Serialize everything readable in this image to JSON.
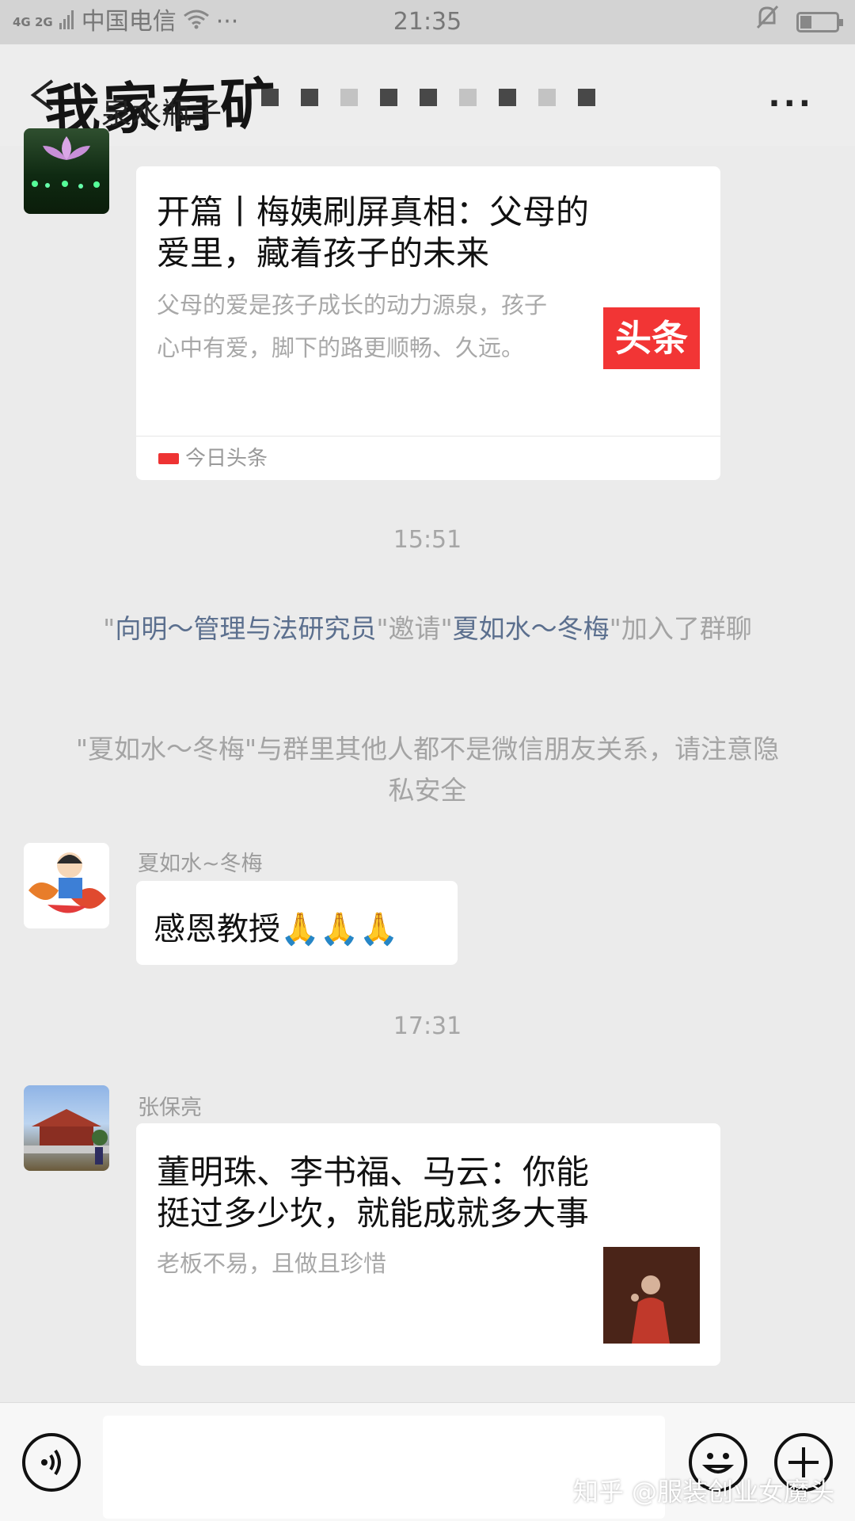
{
  "status_bar": {
    "network": "4G 2G",
    "carrier": "中国电信",
    "dots": "···",
    "time": "21:35"
  },
  "title_bar": {
    "title": "我家有矿",
    "subtitle": "泉水瓶子"
  },
  "messages": [
    {
      "type": "card",
      "title": "开篇丨梅姨刷屏真相：父母的爱里，藏着孩子的未来",
      "description": "父母的爱是孩子成长的动力源泉，孩子心中有爱，脚下的路更顺畅、久远。",
      "thumb_text": "头条",
      "source": "今日头条"
    },
    {
      "type": "time",
      "text": "15:51"
    },
    {
      "type": "system",
      "q1": "\"",
      "inviter": "向明～管理与法研究员",
      "mid": "\"邀请\"",
      "invitee": "夏如水～冬梅",
      "tail": "\"加入了群聊"
    },
    {
      "type": "system",
      "text": "\"夏如水～冬梅\"与群里其他人都不是微信朋友关系，请注意隐私安全"
    },
    {
      "type": "text",
      "sender": "夏如水~冬梅",
      "text": "感恩教授",
      "emoji": "🙏🙏🙏"
    },
    {
      "type": "time",
      "text": "17:31"
    },
    {
      "type": "card",
      "sender": "张保亮",
      "title": "董明珠、李书福、马云：你能挺过多少坎，就能成就多大事",
      "description": "老板不易，且做且珍惜"
    }
  ],
  "input_bar": {
    "input_value": ""
  },
  "watermark": "知乎 @服装创业女魔头",
  "colors": {
    "bg": "#ebebeb",
    "bubble": "#ffffff",
    "link": "#5b6f8e",
    "toutiao_red": "#f23535"
  }
}
